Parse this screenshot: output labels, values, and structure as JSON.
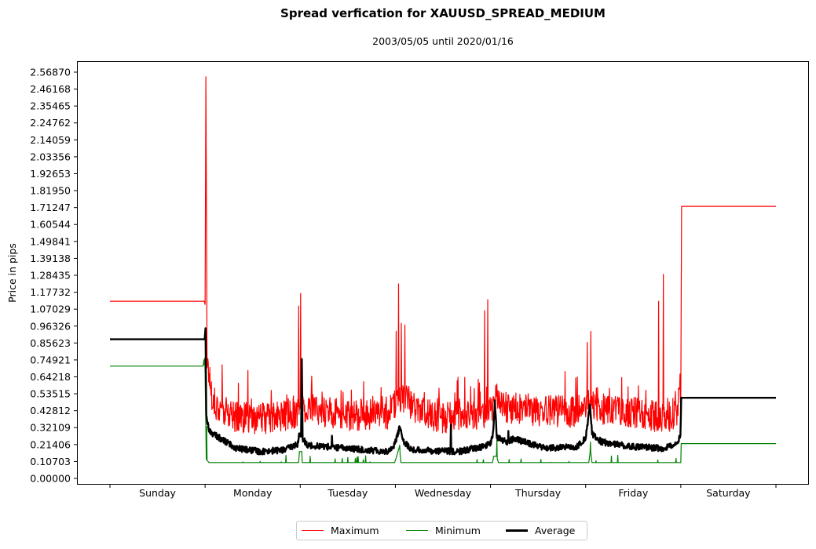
{
  "chart_data": {
    "type": "line",
    "title": "Spread verfication for XAUUSD_SPREAD_MEDIUM",
    "subtitle": "2003/05/05 until 2020/01/16",
    "xlabel": "",
    "ylabel": "Price in pips",
    "ylim": [
      0.0,
      2.5687
    ],
    "xlim_hours": [
      0,
      168
    ],
    "grid": false,
    "legend_position": "bottom-center",
    "yticks": [
      "0.00000",
      "0.10703",
      "0.21406",
      "0.32109",
      "0.42812",
      "0.53515",
      "0.64218",
      "0.74921",
      "0.85623",
      "0.96326",
      "1.07029",
      "1.17732",
      "1.28435",
      "1.39138",
      "1.49841",
      "1.60544",
      "1.71247",
      "1.81950",
      "1.92653",
      "2.03356",
      "2.14059",
      "2.24762",
      "2.35465",
      "2.46168",
      "2.56870"
    ],
    "xtick_labels": [
      "Sunday",
      "Monday",
      "Tuesday",
      "Wednesday",
      "Thursday",
      "Friday",
      "Saturday"
    ],
    "series": [
      {
        "name": "Maximum",
        "color": "#ff0000",
        "baseline": [
          [
            0,
            1.12
          ],
          [
            23.8,
            1.12
          ],
          [
            24,
            1.1
          ],
          [
            24.2,
            2.54
          ],
          [
            24.5,
            0.75
          ],
          [
            26,
            0.48
          ],
          [
            30,
            0.4
          ],
          [
            36,
            0.38
          ],
          [
            41,
            0.38
          ],
          [
            47.5,
            0.42
          ],
          [
            49,
            0.45
          ],
          [
            52,
            0.43
          ],
          [
            60,
            0.4
          ],
          [
            70,
            0.41
          ],
          [
            72,
            0.45
          ],
          [
            74,
            0.52
          ],
          [
            78,
            0.42
          ],
          [
            84,
            0.38
          ],
          [
            94,
            0.41
          ],
          [
            97,
            0.46
          ],
          [
            100,
            0.45
          ],
          [
            108,
            0.43
          ],
          [
            118,
            0.42
          ],
          [
            121,
            0.47
          ],
          [
            124,
            0.44
          ],
          [
            132,
            0.42
          ],
          [
            140,
            0.38
          ],
          [
            143,
            0.42
          ],
          [
            144,
            0.55
          ],
          [
            144.2,
            1.72
          ],
          [
            168,
            1.72
          ]
        ],
        "spikes": [
          [
            47.6,
            1.09
          ],
          [
            48.1,
            1.17
          ],
          [
            72.2,
            0.93
          ],
          [
            72.8,
            1.23
          ],
          [
            73.5,
            0.98
          ],
          [
            74.4,
            0.97
          ],
          [
            94.5,
            1.06
          ],
          [
            95.3,
            1.13
          ],
          [
            120.4,
            0.86
          ],
          [
            121.3,
            0.93
          ],
          [
            138.4,
            1.12
          ],
          [
            139.6,
            1.29
          ],
          [
            143.8,
            0.66
          ]
        ],
        "noise_amplitude": 0.1
      },
      {
        "name": "Minimum",
        "color": "#008000",
        "baseline": [
          [
            0,
            0.71
          ],
          [
            23.5,
            0.71
          ],
          [
            23.7,
            0.75
          ],
          [
            24,
            0.66
          ],
          [
            24.3,
            0.12
          ],
          [
            25,
            0.1
          ],
          [
            47.6,
            0.1
          ],
          [
            47.8,
            0.17
          ],
          [
            48.4,
            0.17
          ],
          [
            48.5,
            0.1
          ],
          [
            71.8,
            0.1
          ],
          [
            72.2,
            0.13
          ],
          [
            73,
            0.2
          ],
          [
            73.4,
            0.1
          ],
          [
            96.5,
            0.1
          ],
          [
            96.8,
            0.14
          ],
          [
            97.5,
            0.14
          ],
          [
            98,
            0.1
          ],
          [
            120.8,
            0.1
          ],
          [
            121.2,
            0.18
          ],
          [
            121.6,
            0.1
          ],
          [
            144,
            0.1
          ],
          [
            144.1,
            0.22
          ],
          [
            168,
            0.22
          ]
        ],
        "spikes": [
          [
            23.9,
            0.76
          ],
          [
            24.4,
            0.33
          ],
          [
            73.1,
            0.21
          ],
          [
            97.6,
            0.25
          ],
          [
            121.2,
            0.23
          ]
        ],
        "noise_amplitude": 0.0
      },
      {
        "name": "Average",
        "color": "#000000",
        "baseline": [
          [
            0,
            0.88
          ],
          [
            23.9,
            0.88
          ],
          [
            24.1,
            0.95
          ],
          [
            24.3,
            0.4
          ],
          [
            25,
            0.3
          ],
          [
            28,
            0.25
          ],
          [
            32,
            0.19
          ],
          [
            38,
            0.17
          ],
          [
            44,
            0.18
          ],
          [
            47.5,
            0.22
          ],
          [
            47.7,
            0.27
          ],
          [
            48.2,
            0.26
          ],
          [
            48.4,
            0.74
          ],
          [
            48.6,
            0.25
          ],
          [
            50,
            0.21
          ],
          [
            60,
            0.19
          ],
          [
            70,
            0.17
          ],
          [
            71.5,
            0.2
          ],
          [
            72.5,
            0.27
          ],
          [
            73.2,
            0.33
          ],
          [
            74,
            0.24
          ],
          [
            76,
            0.18
          ],
          [
            88,
            0.17
          ],
          [
            94,
            0.2
          ],
          [
            96,
            0.22
          ],
          [
            96.6,
            0.27
          ],
          [
            97.1,
            0.49
          ],
          [
            97.6,
            0.26
          ],
          [
            100,
            0.23
          ],
          [
            102,
            0.25
          ],
          [
            110,
            0.19
          ],
          [
            118,
            0.2
          ],
          [
            120,
            0.26
          ],
          [
            121.1,
            0.47
          ],
          [
            121.6,
            0.28
          ],
          [
            124,
            0.23
          ],
          [
            132,
            0.2
          ],
          [
            140,
            0.19
          ],
          [
            143,
            0.23
          ],
          [
            143.9,
            0.27
          ],
          [
            144.1,
            0.51
          ],
          [
            168,
            0.51
          ]
        ],
        "spikes": [
          [
            56,
            0.27
          ],
          [
            86,
            0.34
          ],
          [
            100.5,
            0.3
          ]
        ],
        "noise_amplitude": 0.02
      }
    ]
  }
}
